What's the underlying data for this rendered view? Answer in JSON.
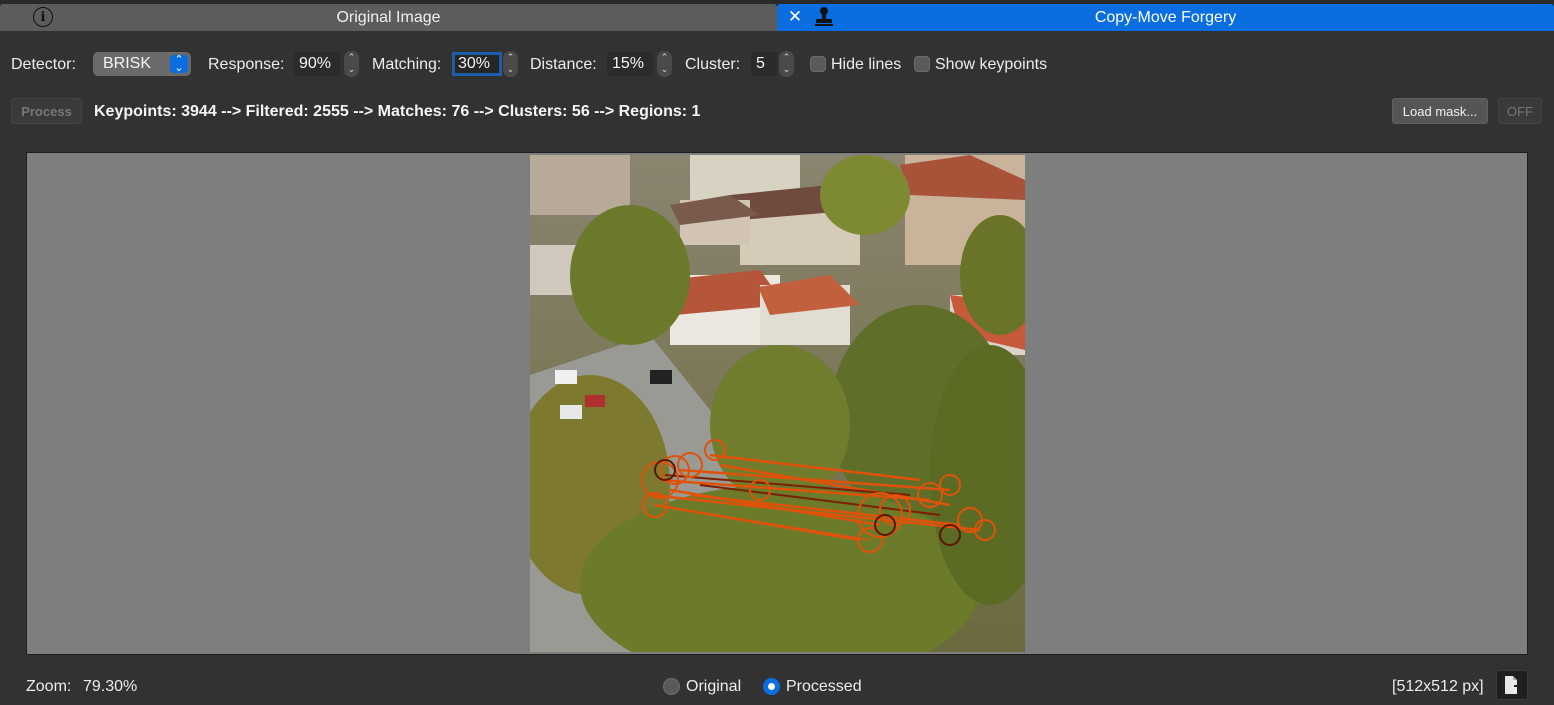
{
  "tabs": {
    "left": {
      "title": "Original Image",
      "icon": "info-icon"
    },
    "right": {
      "title": "Copy-Move Forgery",
      "icon": "stamp-icon",
      "close": "✕",
      "active_color": "#0a6ee0"
    }
  },
  "toolbar": {
    "detector_label": "Detector:",
    "detector_value": "BRISK",
    "response_label": "Response:",
    "response_value": "90%",
    "matching_label": "Matching:",
    "matching_value": "30%",
    "distance_label": "Distance:",
    "distance_value": "15%",
    "cluster_label": "Cluster:",
    "cluster_value": "5",
    "hide_lines_label": "Hide lines",
    "hide_lines_checked": false,
    "show_keypoints_label": "Show keypoints",
    "show_keypoints_checked": false
  },
  "row2": {
    "process_label": "Process",
    "status": "Keypoints: 3944 --> Filtered: 2555 --> Matches: 76 --> Clusters: 56 --> Regions: 1",
    "load_mask_label": "Load mask...",
    "off_label": "OFF"
  },
  "bottom": {
    "zoom_label": "Zoom:",
    "zoom_value": "79.30%",
    "radio_original": "Original",
    "radio_processed": "Processed",
    "selected_view": "Processed",
    "image_size": "[512x512 px]",
    "export_icon": "export-icon"
  },
  "colors": {
    "accent": "#0a6ee0",
    "match_lines": "#e0520a",
    "match_dark": "#6a1a00"
  }
}
